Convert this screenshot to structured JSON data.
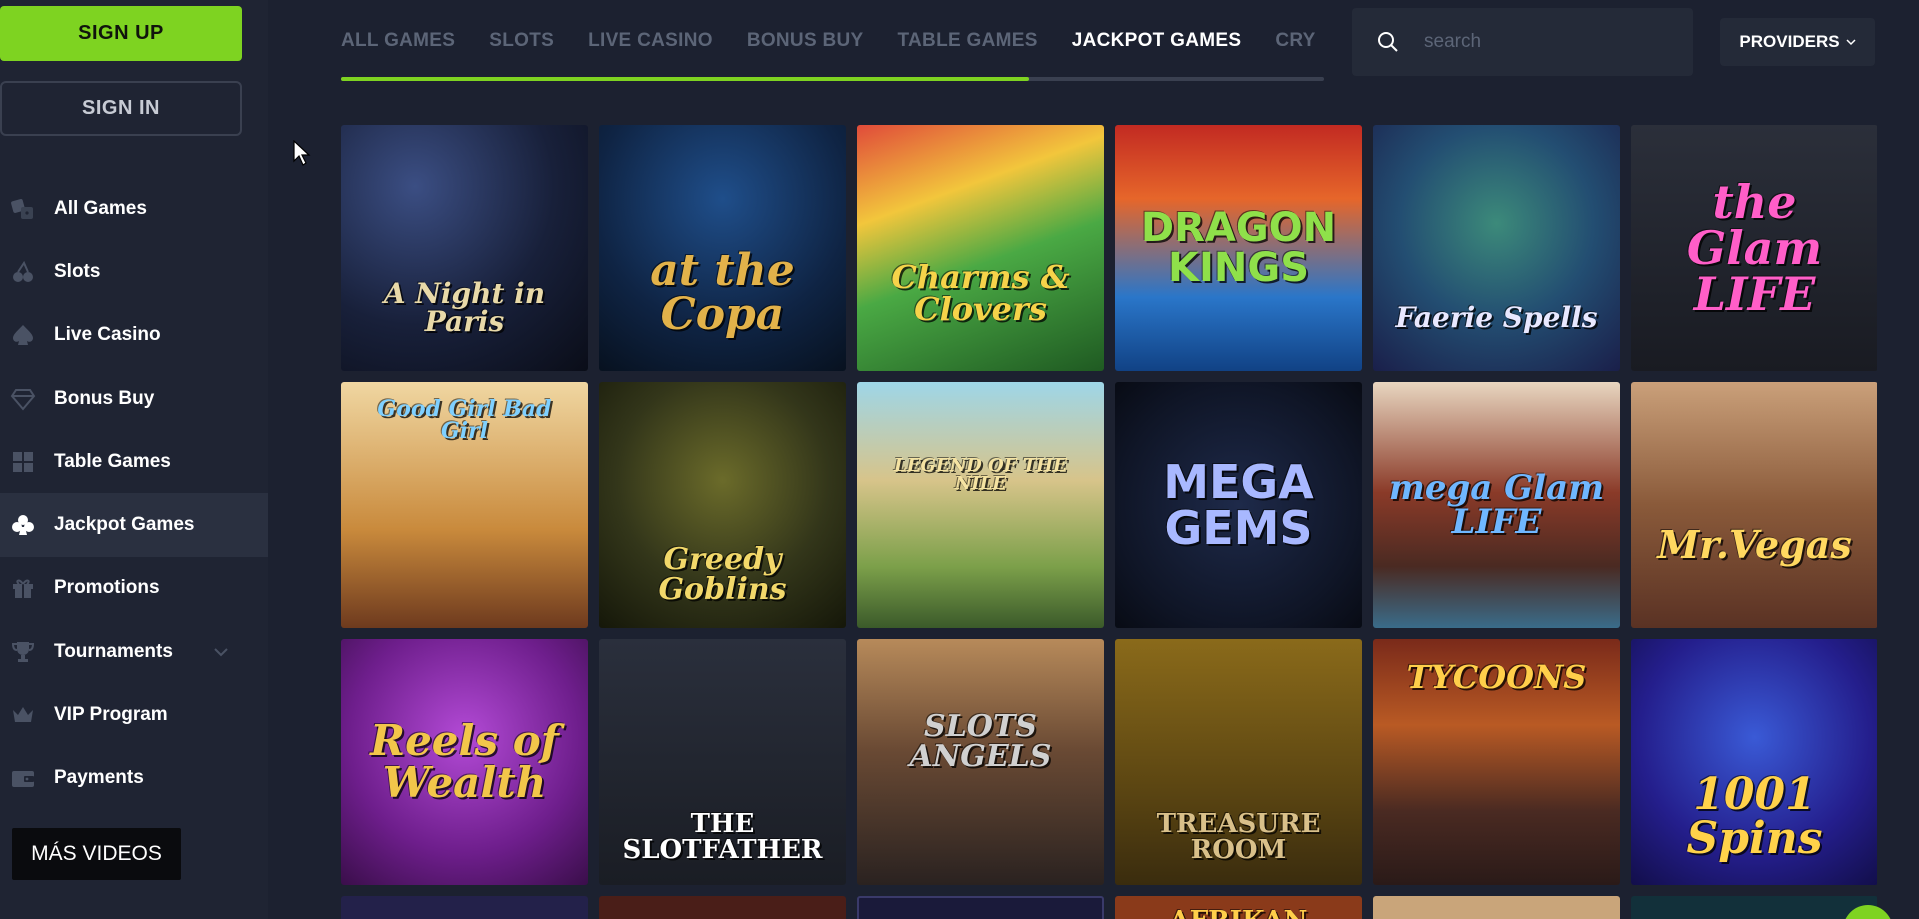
{
  "auth": {
    "signup_label": "SIGN UP",
    "signin_label": "SIGN IN"
  },
  "sidebar": {
    "items": [
      {
        "label": "All Games",
        "icon": "dice-icon"
      },
      {
        "label": "Slots",
        "icon": "cherries-icon"
      },
      {
        "label": "Live Casino",
        "icon": "spade-icon"
      },
      {
        "label": "Bonus Buy",
        "icon": "diamond-icon"
      },
      {
        "label": "Table Games",
        "icon": "grid-icon"
      },
      {
        "label": "Jackpot Games",
        "icon": "club-icon",
        "active": true
      },
      {
        "label": "Promotions",
        "icon": "gift-icon"
      },
      {
        "label": "Tournaments",
        "icon": "trophy-icon",
        "has_dropdown": true
      },
      {
        "label": "VIP Program",
        "icon": "crown-icon"
      },
      {
        "label": "Payments",
        "icon": "wallet-icon"
      }
    ]
  },
  "overlay_badge": "MÁS VIDEOS",
  "tabs": {
    "items": [
      "ALL GAMES",
      "SLOTS",
      "LIVE CASINO",
      "BONUS BUY",
      "TABLE GAMES",
      "JACKPOT GAMES",
      "CRY"
    ],
    "active_index": 5,
    "scroll_progress": 0.7
  },
  "search": {
    "placeholder": "search",
    "value": ""
  },
  "providers_label": "PROVIDERS",
  "games": [
    {
      "title": "A Night in Paris"
    },
    {
      "title": "at the Copa"
    },
    {
      "title": "Charms & Clovers"
    },
    {
      "title": "DRAGON KINGS"
    },
    {
      "title": "Faerie Spells"
    },
    {
      "title": "the Glam LIFE"
    },
    {
      "title": "Good Girl Bad Girl"
    },
    {
      "title": "Greedy Goblins"
    },
    {
      "title": "LEGEND OF THE NILE"
    },
    {
      "title": "MEGA GEMS"
    },
    {
      "title": "mega Glam LIFE"
    },
    {
      "title": "Mr.Vegas"
    },
    {
      "title": "Reels of Wealth"
    },
    {
      "title": "THE SLOTFATHER"
    },
    {
      "title": "SLOTS ANGELS"
    },
    {
      "title": "TREASURE ROOM"
    },
    {
      "title": "TYCOONS"
    },
    {
      "title": "1001 Spins"
    },
    {
      "title": ""
    },
    {
      "title": ""
    },
    {
      "title": ""
    },
    {
      "title": "AFRIKAN"
    },
    {
      "title": ""
    },
    {
      "title": ""
    }
  ],
  "colors": {
    "accent": "#7ed321",
    "background": "#1c2130",
    "sidebar": "#1f2433",
    "muted_text": "#5c6577"
  }
}
